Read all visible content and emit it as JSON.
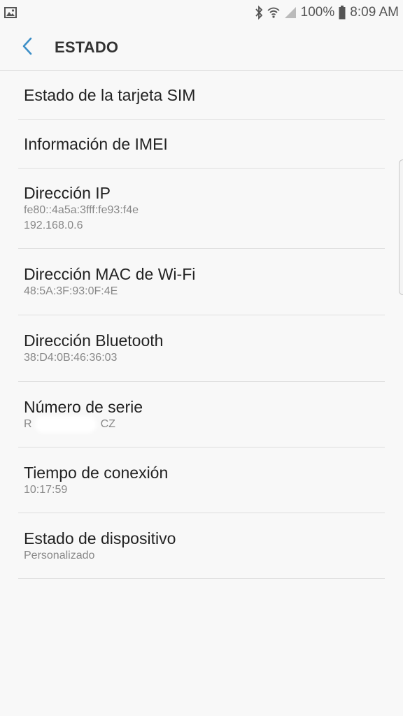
{
  "status_bar": {
    "battery": "100%",
    "time": "8:09 AM"
  },
  "header": {
    "title": "ESTADO"
  },
  "items": [
    {
      "title": "Estado de la tarjeta SIM"
    },
    {
      "title": "Información de IMEI"
    },
    {
      "title": "Dirección IP",
      "sub1": "fe80::4a5a:3fff:fe93:f4e",
      "sub2": "192.168.0.6"
    },
    {
      "title": "Dirección MAC de Wi-Fi",
      "sub1": "48:5A:3F:93:0F:4E"
    },
    {
      "title": "Dirección Bluetooth",
      "sub1": "38:D4:0B:46:36:03"
    },
    {
      "title": "Número de serie",
      "serial_start": "R",
      "serial_end": "CZ"
    },
    {
      "title": "Tiempo de conexión",
      "sub1": "10:17:59"
    },
    {
      "title": "Estado de dispositivo",
      "sub1": "Personalizado"
    }
  ],
  "icons": {
    "gallery": "gallery-notification-icon",
    "bluetooth": "bluetooth-icon",
    "wifi": "wifi-icon",
    "signal": "signal-icon",
    "battery": "battery-icon",
    "back": "back-arrow-icon"
  },
  "colors": {
    "accent": "#3d8fc7",
    "background": "#f8f8f8"
  }
}
